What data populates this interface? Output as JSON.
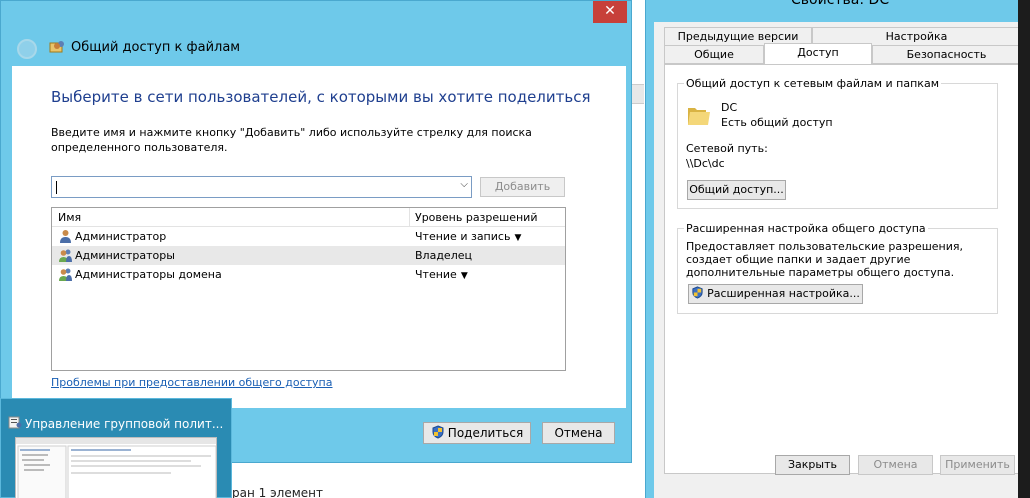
{
  "share_dialog": {
    "title": "Общий доступ к файлам",
    "heading": "Выберите в сети пользователей, с которыми вы хотите поделиться",
    "instructions": "Введите имя и нажмите кнопку \"Добавить\" либо используйте стрелку для поиска определенного пользователя.",
    "input_value": "",
    "add_button": "Добавить",
    "columns": {
      "name": "Имя",
      "permission": "Уровень разрешений"
    },
    "rows": [
      {
        "name": "Администратор",
        "permission": "Чтение и запись",
        "has_dropdown": true,
        "selected": false,
        "icon": "user-icon"
      },
      {
        "name": "Администраторы",
        "permission": "Владелец",
        "has_dropdown": false,
        "selected": true,
        "icon": "group-icon"
      },
      {
        "name": "Администраторы домена",
        "permission": "Чтение",
        "has_dropdown": true,
        "selected": false,
        "icon": "group-icon"
      }
    ],
    "help_link": "Проблемы при предоставлении общего доступа",
    "share_button": "Поделиться",
    "cancel_button": "Отмена",
    "close_glyph": "✕"
  },
  "properties_dialog": {
    "title": "Свойства: DC",
    "tabs_row1": [
      "Предыдущие версии",
      "Настройка"
    ],
    "tabs_row2": [
      "Общие",
      "Доступ",
      "Безопасность"
    ],
    "active_tab": "Доступ",
    "network_group": {
      "title": "Общий доступ к сетевым файлам и папкам",
      "folder_name": "DC",
      "folder_status": "Есть общий доступ",
      "path_label": "Сетевой путь:",
      "path_value": "\\\\Dc\\dc",
      "button": "Общий доступ..."
    },
    "advanced_group": {
      "title": "Расширенная настройка общего доступа",
      "description": "Предоставляет пользовательские разрешения, создает общие папки и задает другие дополнительные параметры общего доступа.",
      "button": "Расширенная настройка..."
    },
    "ok_button": "Закрыть",
    "cancel_button": "Отмена",
    "apply_button": "Применить"
  },
  "taskbar_thumb": {
    "title": "Управление групповой полит..."
  },
  "background": {
    "status_text": "ран 1 элемент"
  },
  "colors": {
    "chrome_blue": "#6ec9ea",
    "close_red": "#c7403a",
    "heading_blue": "#1f3f8f",
    "link_blue": "#1a5fb4"
  }
}
